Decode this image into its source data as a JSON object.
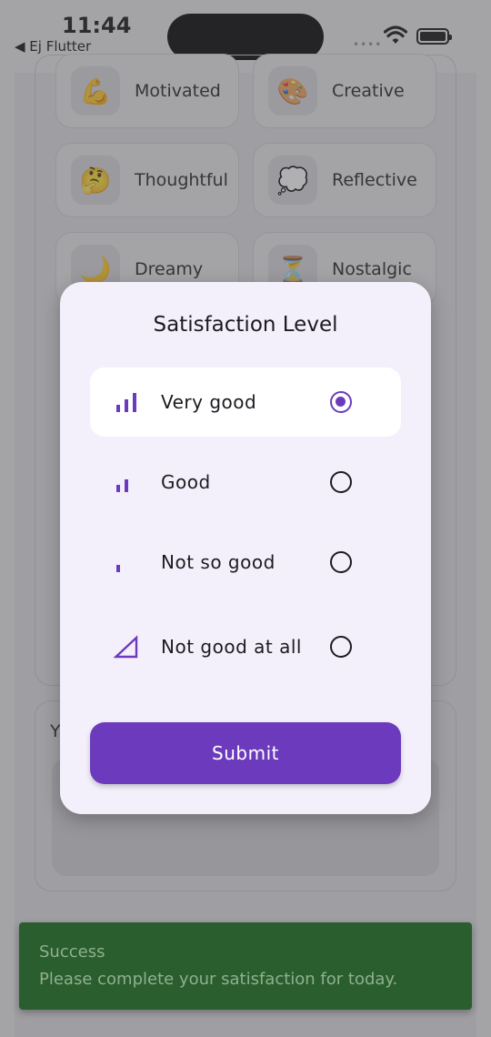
{
  "status_bar": {
    "time": "11:44",
    "back_app": "◀ Ej Flutter",
    "signal": "••••"
  },
  "moods": [
    {
      "emoji": "💪",
      "label": "Motivated"
    },
    {
      "emoji": "🎨",
      "label": "Creative"
    },
    {
      "emoji": "🤔",
      "label": "Thoughtful"
    },
    {
      "emoji": "💭",
      "label": "Reflective"
    },
    {
      "emoji": "🌙",
      "label": "Dreamy"
    },
    {
      "emoji": "⏳",
      "label": "Nostalgic"
    }
  ],
  "note": {
    "title": "Y"
  },
  "modal": {
    "title": "Satisfaction Level",
    "options": [
      {
        "label": "Very good",
        "icon": "signal-bars-3-icon",
        "selected": true
      },
      {
        "label": "Good",
        "icon": "signal-bars-2-icon",
        "selected": false
      },
      {
        "label": "Not so good",
        "icon": "signal-bars-1-icon",
        "selected": false
      },
      {
        "label": "Not good at all",
        "icon": "signal-empty-icon",
        "selected": false
      }
    ],
    "submit_label": "Submit"
  },
  "snackbar": {
    "title": "Success",
    "message": "Please complete your satisfaction for today."
  },
  "colors": {
    "accent": "#6c3bbd",
    "snackbar": "#2b5e2e",
    "modal_bg": "#f4f0fb"
  }
}
